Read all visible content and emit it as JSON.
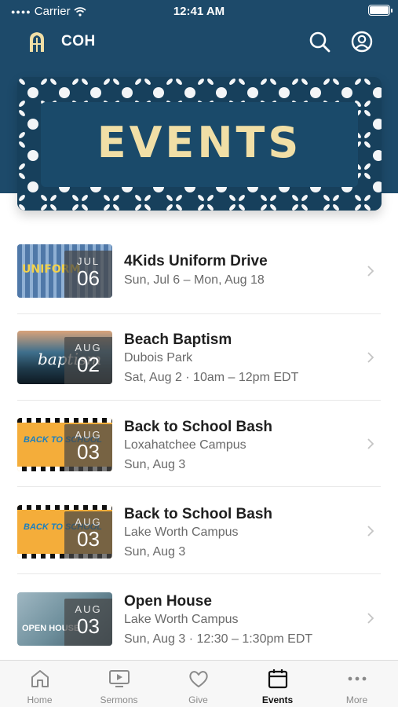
{
  "status_bar": {
    "carrier": "Carrier",
    "time": "12:41 AM"
  },
  "header": {
    "brand": "COH",
    "logo_icon": "church-window-icon",
    "search_icon": "search-icon",
    "profile_icon": "profile-icon"
  },
  "banner": {
    "title": "EVENTS"
  },
  "events": [
    {
      "title": "4Kids Uniform Drive",
      "lines": [
        "Sun, Jul 6 – Mon, Aug 18"
      ],
      "month": "JUL",
      "day": "06",
      "thumb_text": "UNIFORM"
    },
    {
      "title": "Beach Baptism",
      "lines": [
        "Dubois Park",
        "Sat, Aug 2 · 10am – 12pm EDT"
      ],
      "month": "AUG",
      "day": "02",
      "thumb_text": "baptism"
    },
    {
      "title": "Back to School Bash",
      "lines": [
        "Loxahatchee Campus",
        "Sun, Aug 3"
      ],
      "month": "AUG",
      "day": "03",
      "thumb_text": "BACK TO SCHOOL"
    },
    {
      "title": "Back to School Bash",
      "lines": [
        "Lake Worth Campus",
        "Sun, Aug 3"
      ],
      "month": "AUG",
      "day": "03",
      "thumb_text": "BACK TO SCHOOL"
    },
    {
      "title": "Open House",
      "lines": [
        "Lake Worth Campus",
        "Sun, Aug 3 · 12:30 – 1:30pm EDT"
      ],
      "month": "AUG",
      "day": "03",
      "thumb_text": "OPEN HOUSE"
    }
  ],
  "tabs": [
    {
      "label": "Home",
      "icon": "home-icon",
      "active": false
    },
    {
      "label": "Sermons",
      "icon": "tv-icon",
      "active": false
    },
    {
      "label": "Give",
      "icon": "heart-icon",
      "active": false
    },
    {
      "label": "Events",
      "icon": "calendar-icon",
      "active": true
    },
    {
      "label": "More",
      "icon": "more-dots-icon",
      "active": false
    }
  ],
  "colors": {
    "header_bg": "#1d4a6a",
    "banner_text": "#f1dfa6",
    "active_tab": "#111111",
    "inactive_tab": "#8a8a8a"
  }
}
